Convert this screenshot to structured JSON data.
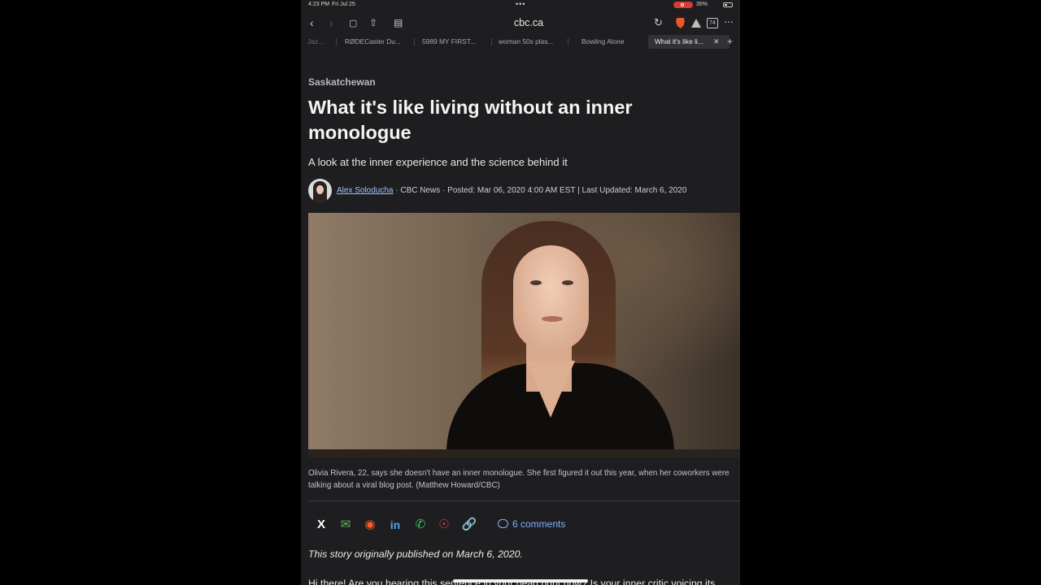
{
  "status_bar": {
    "time": "4:23 PM",
    "date": "Fri Jul 25",
    "battery": "35%"
  },
  "toolbar": {
    "url": "cbc.ca",
    "tab_count": "74"
  },
  "tabs": [
    {
      "label": "Jaz..."
    },
    {
      "label": "RØDECaster Du..."
    },
    {
      "label": "5989 MY FIRST..."
    },
    {
      "label": "woman 50s plas..."
    },
    {
      "label": "Bowling Alone"
    },
    {
      "label": "What it's like li..."
    }
  ],
  "article": {
    "section": "Saskatchewan",
    "headline": "What it's like living without an inner monologue",
    "deck": "A look at the inner experience and the science behind it",
    "author": "Alex Soloducha",
    "meta": " · CBC News · Posted: Mar 06, 2020 4:00 AM EST | Last Updated: March 6, 2020",
    "caption": "Olivia Rivera, 22, says she doesn't have an inner monologue. She first figured it out this year, when her coworkers were talking about a viral blog post. (Matthew Howard/CBC)",
    "comments": "6 comments",
    "note": "This story originally published on March 6, 2020.",
    "body_start": "Hi there! Are you hearing this sentence in your head right now? Is your inner critic voicing its"
  },
  "colors": {
    "page_bg": "#1e1e20",
    "link": "#9ec1ff",
    "comments": "#7fb0ff"
  }
}
